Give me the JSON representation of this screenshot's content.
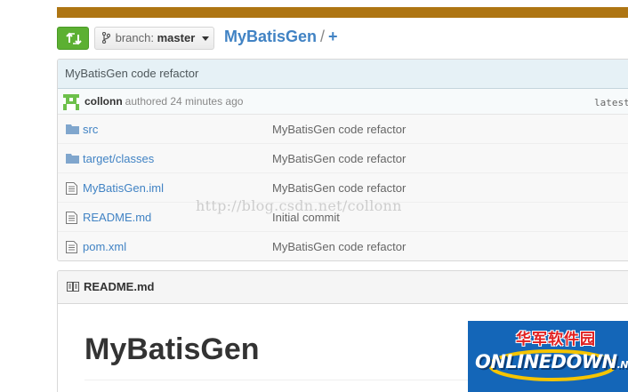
{
  "colors": {
    "topbar": "#ae7513",
    "link": "#4183c4",
    "compare_button": "#5cb032",
    "commit_bar": "#e6f1f6",
    "watermark_logo_bg": "#1466b8"
  },
  "toolbar": {
    "compare_icon": "compare-arrows-icon",
    "branch_label": "branch:",
    "branch_name": "master",
    "repo_name": "MyBatisGen",
    "path_separator": "/",
    "add_file": "+"
  },
  "commit": {
    "message": "MyBatisGen code refactor",
    "author": "collonn",
    "authored_text": "authored 24 minutes ago",
    "latest_label": "latest"
  },
  "files": [
    {
      "icon": "folder-icon",
      "name_prefix": "",
      "name": "src",
      "message": "MyBatisGen code refactor"
    },
    {
      "icon": "folder-icon",
      "name_prefix": "target/",
      "name": "classes",
      "message": "MyBatisGen code refactor"
    },
    {
      "icon": "file-icon",
      "name_prefix": "",
      "name": "MyBatisGen.iml",
      "message": "MyBatisGen code refactor"
    },
    {
      "icon": "file-icon",
      "name_prefix": "",
      "name": "README.md",
      "message": "Initial commit"
    },
    {
      "icon": "file-icon",
      "name_prefix": "",
      "name": "pom.xml",
      "message": "MyBatisGen code refactor"
    }
  ],
  "readme": {
    "header": "README.md",
    "heading": "MyBatisGen"
  },
  "watermark": {
    "text": "http://blog.csdn.net/collonn"
  },
  "logo": {
    "chinese": "华军软件园",
    "english": "ONLINEDOWN",
    "suffix": ".NET"
  }
}
